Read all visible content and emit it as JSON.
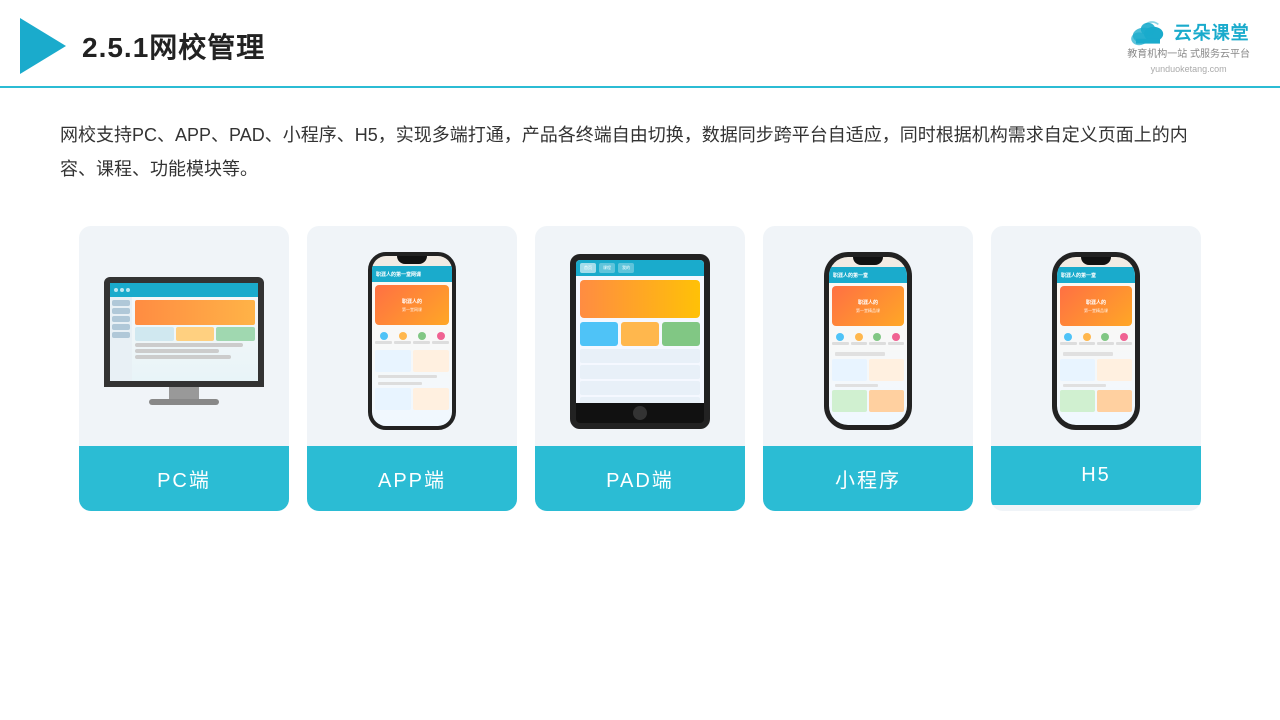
{
  "header": {
    "title": "2.5.1网校管理",
    "brand_name": "云朵课堂",
    "brand_tagline": "教育机构一站\n式服务云平台",
    "brand_url": "yunduoketang.com"
  },
  "description": {
    "text": "网校支持PC、APP、PAD、小程序、H5，实现多端打通，产品各终端自由切换，数据同步跨平台自适应，同时根据机构需求自定义页面上的内容、课程、功能模块等。"
  },
  "cards": [
    {
      "id": "pc",
      "label": "PC端"
    },
    {
      "id": "app",
      "label": "APP端"
    },
    {
      "id": "pad",
      "label": "PAD端"
    },
    {
      "id": "miniapp",
      "label": "小程序"
    },
    {
      "id": "h5",
      "label": "H5"
    }
  ],
  "colors": {
    "accent": "#2BBCD4",
    "header_border": "#2BBCD4",
    "card_label_bg": "#2BBCD4"
  }
}
